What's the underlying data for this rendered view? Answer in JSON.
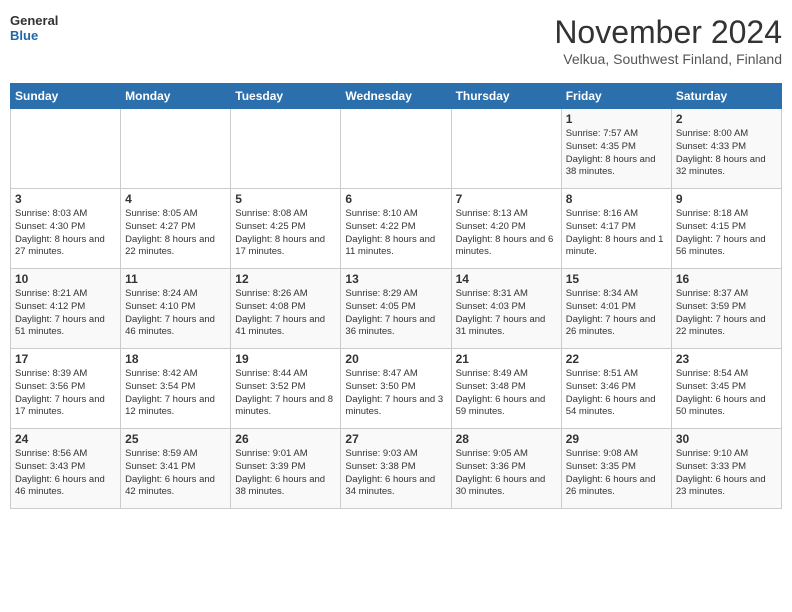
{
  "logo": {
    "line1": "General",
    "line2": "Blue"
  },
  "title": "November 2024",
  "subtitle": "Velkua, Southwest Finland, Finland",
  "weekdays": [
    "Sunday",
    "Monday",
    "Tuesday",
    "Wednesday",
    "Thursday",
    "Friday",
    "Saturday"
  ],
  "weeks": [
    [
      {
        "day": "",
        "content": ""
      },
      {
        "day": "",
        "content": ""
      },
      {
        "day": "",
        "content": ""
      },
      {
        "day": "",
        "content": ""
      },
      {
        "day": "",
        "content": ""
      },
      {
        "day": "1",
        "content": "Sunrise: 7:57 AM\nSunset: 4:35 PM\nDaylight: 8 hours and 38 minutes."
      },
      {
        "day": "2",
        "content": "Sunrise: 8:00 AM\nSunset: 4:33 PM\nDaylight: 8 hours and 32 minutes."
      }
    ],
    [
      {
        "day": "3",
        "content": "Sunrise: 8:03 AM\nSunset: 4:30 PM\nDaylight: 8 hours and 27 minutes."
      },
      {
        "day": "4",
        "content": "Sunrise: 8:05 AM\nSunset: 4:27 PM\nDaylight: 8 hours and 22 minutes."
      },
      {
        "day": "5",
        "content": "Sunrise: 8:08 AM\nSunset: 4:25 PM\nDaylight: 8 hours and 17 minutes."
      },
      {
        "day": "6",
        "content": "Sunrise: 8:10 AM\nSunset: 4:22 PM\nDaylight: 8 hours and 11 minutes."
      },
      {
        "day": "7",
        "content": "Sunrise: 8:13 AM\nSunset: 4:20 PM\nDaylight: 8 hours and 6 minutes."
      },
      {
        "day": "8",
        "content": "Sunrise: 8:16 AM\nSunset: 4:17 PM\nDaylight: 8 hours and 1 minute."
      },
      {
        "day": "9",
        "content": "Sunrise: 8:18 AM\nSunset: 4:15 PM\nDaylight: 7 hours and 56 minutes."
      }
    ],
    [
      {
        "day": "10",
        "content": "Sunrise: 8:21 AM\nSunset: 4:12 PM\nDaylight: 7 hours and 51 minutes."
      },
      {
        "day": "11",
        "content": "Sunrise: 8:24 AM\nSunset: 4:10 PM\nDaylight: 7 hours and 46 minutes."
      },
      {
        "day": "12",
        "content": "Sunrise: 8:26 AM\nSunset: 4:08 PM\nDaylight: 7 hours and 41 minutes."
      },
      {
        "day": "13",
        "content": "Sunrise: 8:29 AM\nSunset: 4:05 PM\nDaylight: 7 hours and 36 minutes."
      },
      {
        "day": "14",
        "content": "Sunrise: 8:31 AM\nSunset: 4:03 PM\nDaylight: 7 hours and 31 minutes."
      },
      {
        "day": "15",
        "content": "Sunrise: 8:34 AM\nSunset: 4:01 PM\nDaylight: 7 hours and 26 minutes."
      },
      {
        "day": "16",
        "content": "Sunrise: 8:37 AM\nSunset: 3:59 PM\nDaylight: 7 hours and 22 minutes."
      }
    ],
    [
      {
        "day": "17",
        "content": "Sunrise: 8:39 AM\nSunset: 3:56 PM\nDaylight: 7 hours and 17 minutes."
      },
      {
        "day": "18",
        "content": "Sunrise: 8:42 AM\nSunset: 3:54 PM\nDaylight: 7 hours and 12 minutes."
      },
      {
        "day": "19",
        "content": "Sunrise: 8:44 AM\nSunset: 3:52 PM\nDaylight: 7 hours and 8 minutes."
      },
      {
        "day": "20",
        "content": "Sunrise: 8:47 AM\nSunset: 3:50 PM\nDaylight: 7 hours and 3 minutes."
      },
      {
        "day": "21",
        "content": "Sunrise: 8:49 AM\nSunset: 3:48 PM\nDaylight: 6 hours and 59 minutes."
      },
      {
        "day": "22",
        "content": "Sunrise: 8:51 AM\nSunset: 3:46 PM\nDaylight: 6 hours and 54 minutes."
      },
      {
        "day": "23",
        "content": "Sunrise: 8:54 AM\nSunset: 3:45 PM\nDaylight: 6 hours and 50 minutes."
      }
    ],
    [
      {
        "day": "24",
        "content": "Sunrise: 8:56 AM\nSunset: 3:43 PM\nDaylight: 6 hours and 46 minutes."
      },
      {
        "day": "25",
        "content": "Sunrise: 8:59 AM\nSunset: 3:41 PM\nDaylight: 6 hours and 42 minutes."
      },
      {
        "day": "26",
        "content": "Sunrise: 9:01 AM\nSunset: 3:39 PM\nDaylight: 6 hours and 38 minutes."
      },
      {
        "day": "27",
        "content": "Sunrise: 9:03 AM\nSunset: 3:38 PM\nDaylight: 6 hours and 34 minutes."
      },
      {
        "day": "28",
        "content": "Sunrise: 9:05 AM\nSunset: 3:36 PM\nDaylight: 6 hours and 30 minutes."
      },
      {
        "day": "29",
        "content": "Sunrise: 9:08 AM\nSunset: 3:35 PM\nDaylight: 6 hours and 26 minutes."
      },
      {
        "day": "30",
        "content": "Sunrise: 9:10 AM\nSunset: 3:33 PM\nDaylight: 6 hours and 23 minutes."
      }
    ]
  ]
}
